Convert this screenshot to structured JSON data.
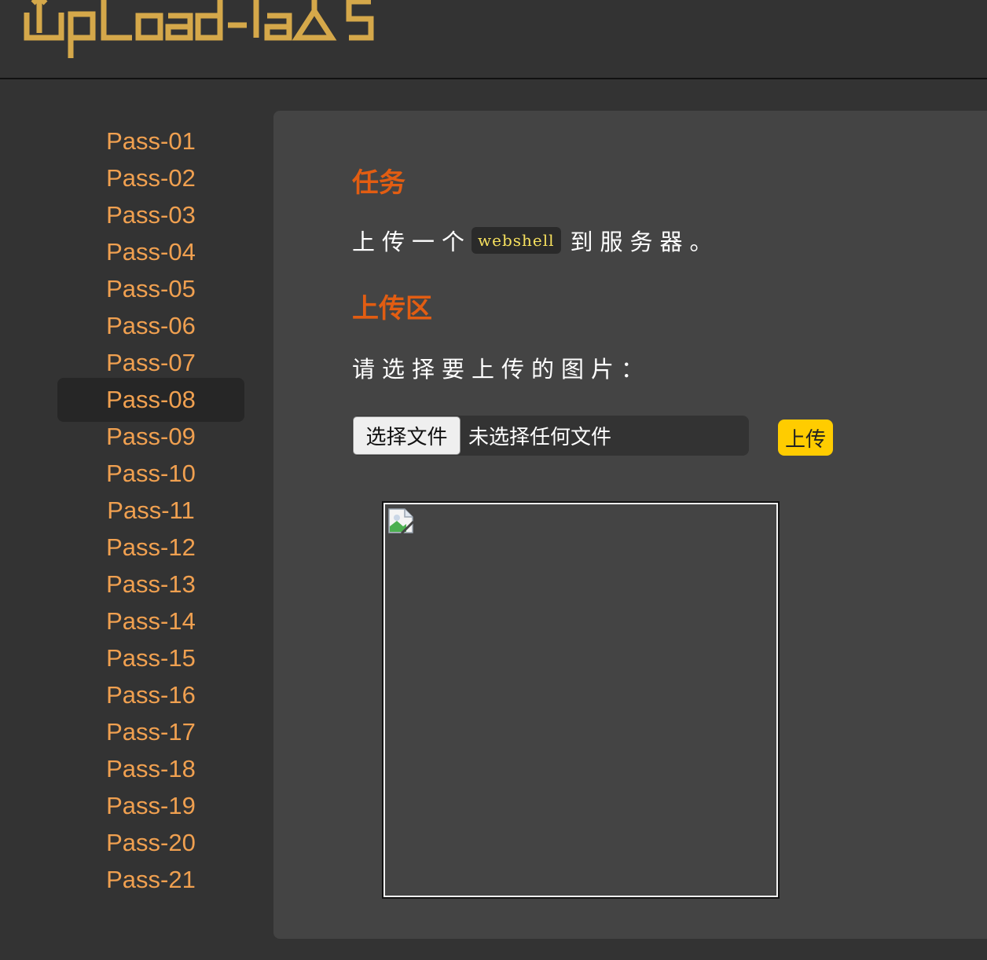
{
  "header": {
    "logo_text": "Upload-labs",
    "logo_color": "#d5a84a"
  },
  "sidebar": {
    "items": [
      {
        "label": "Pass-01"
      },
      {
        "label": "Pass-02"
      },
      {
        "label": "Pass-03"
      },
      {
        "label": "Pass-04"
      },
      {
        "label": "Pass-05"
      },
      {
        "label": "Pass-06"
      },
      {
        "label": "Pass-07"
      },
      {
        "label": "Pass-08"
      },
      {
        "label": "Pass-09"
      },
      {
        "label": "Pass-10"
      },
      {
        "label": "Pass-11"
      },
      {
        "label": "Pass-12"
      },
      {
        "label": "Pass-13"
      },
      {
        "label": "Pass-14"
      },
      {
        "label": "Pass-15"
      },
      {
        "label": "Pass-16"
      },
      {
        "label": "Pass-17"
      },
      {
        "label": "Pass-18"
      },
      {
        "label": "Pass-19"
      },
      {
        "label": "Pass-20"
      },
      {
        "label": "Pass-21"
      }
    ],
    "active": "Pass-08",
    "link_color": "#f0a050"
  },
  "main": {
    "task_title": "任务",
    "task_text_before": "上传一个",
    "task_code": "webshell",
    "task_text_after": "到服务器。",
    "upload_title": "上传区",
    "upload_prompt": "请选择要上传的图片：",
    "file_button_label": "选择文件",
    "file_status": "未选择任何文件",
    "upload_button_label": "上传",
    "accent_color": "#e25d12",
    "button_color": "#ffcc00",
    "preview_icon": "broken-image-icon"
  }
}
